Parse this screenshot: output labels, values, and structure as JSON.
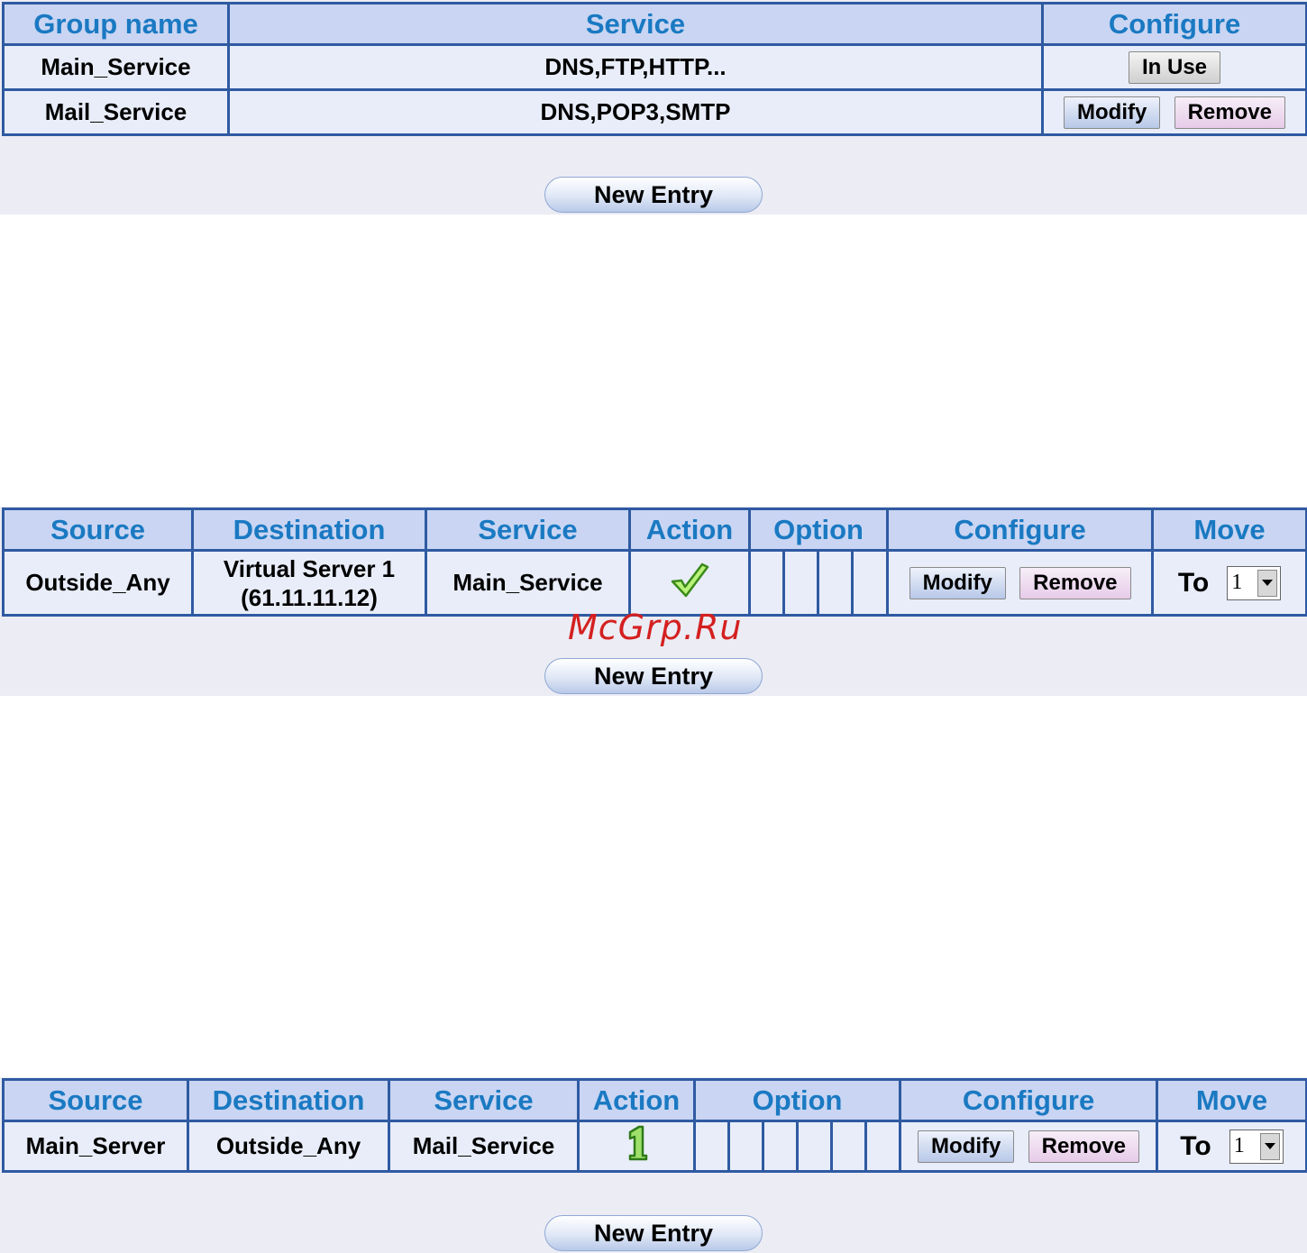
{
  "table1": {
    "headers": [
      "Group name",
      "Service",
      "Configure"
    ],
    "rows": [
      {
        "group": "Main_Service",
        "service": "DNS,FTP,HTTP...",
        "inuse": "In Use"
      },
      {
        "group": "Mail_Service",
        "service": "DNS,POP3,SMTP",
        "modify": "Modify",
        "remove": "Remove"
      }
    ],
    "new_entry": "New Entry"
  },
  "table2": {
    "headers": [
      "Source",
      "Destination",
      "Service",
      "Action",
      "Option",
      "Configure",
      "Move"
    ],
    "row": {
      "source": "Outside_Any",
      "destination_line1": "Virtual Server 1",
      "destination_line2": "(61.11.11.12)",
      "service": "Main_Service",
      "action_icon": "checkmark-icon",
      "modify": "Modify",
      "remove": "Remove",
      "to": "To",
      "move_value": "1"
    },
    "new_entry": "New Entry"
  },
  "table3": {
    "headers": [
      "Source",
      "Destination",
      "Service",
      "Action",
      "Option",
      "Configure",
      "Move"
    ],
    "row": {
      "source": "Main_Server",
      "destination": "Outside_Any",
      "service": "Mail_Service",
      "action_icon": "priority-one-icon",
      "modify": "Modify",
      "remove": "Remove",
      "to": "To",
      "move_value": "1"
    },
    "new_entry": "New Entry"
  },
  "watermark": "McGrp.Ru",
  "colors": {
    "header_bg": "#c9d5f2",
    "header_text": "#1a79c2",
    "cell_bg": "#e8edf9",
    "border": "#2f5aa2",
    "panel_bg": "#ececf4"
  }
}
